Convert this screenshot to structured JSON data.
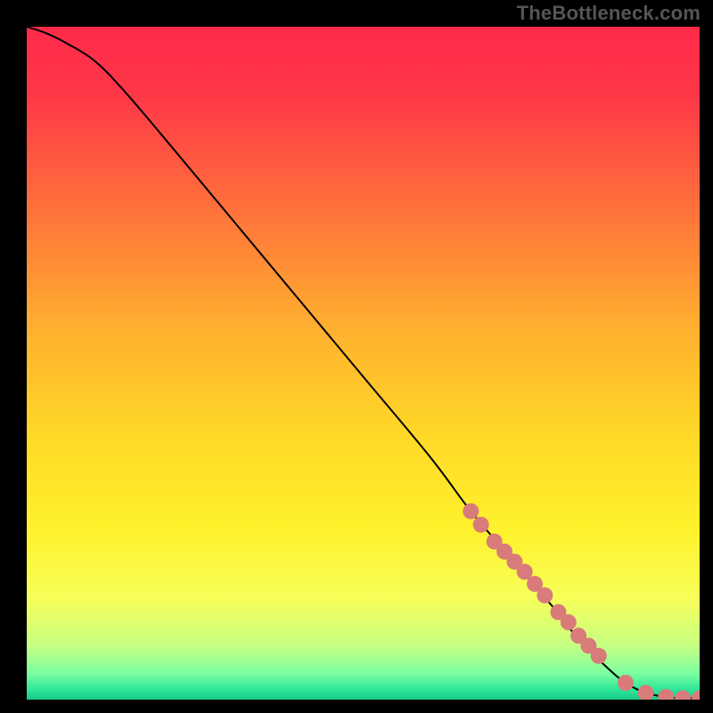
{
  "watermark": "TheBottleneck.com",
  "chart_data": {
    "type": "line",
    "title": "",
    "xlabel": "",
    "ylabel": "",
    "xlim": [
      0,
      100
    ],
    "ylim": [
      0,
      100
    ],
    "background_gradient_stops": [
      {
        "offset": 0.0,
        "color": "#ff2a4a"
      },
      {
        "offset": 0.1,
        "color": "#ff3748"
      },
      {
        "offset": 0.25,
        "color": "#ff6a3c"
      },
      {
        "offset": 0.45,
        "color": "#ffb02f"
      },
      {
        "offset": 0.6,
        "color": "#ffd727"
      },
      {
        "offset": 0.75,
        "color": "#fff22c"
      },
      {
        "offset": 0.85,
        "color": "#f7ff5a"
      },
      {
        "offset": 0.92,
        "color": "#c6ff82"
      },
      {
        "offset": 0.96,
        "color": "#7effa0"
      },
      {
        "offset": 0.985,
        "color": "#2fe69a"
      },
      {
        "offset": 1.0,
        "color": "#16c98a"
      }
    ],
    "series": [
      {
        "name": "curve",
        "x": [
          0,
          3,
          6,
          10,
          14,
          20,
          30,
          40,
          50,
          60,
          66,
          72,
          78,
          82,
          86,
          89,
          92,
          95,
          97,
          100
        ],
        "y": [
          100,
          99,
          97.5,
          95,
          91,
          84,
          72,
          60,
          48,
          36,
          28,
          21,
          14,
          9,
          5,
          2.5,
          1,
          0.4,
          0.2,
          0.2
        ]
      }
    ],
    "markers": {
      "name": "highlighted-points",
      "color": "#d97b7b",
      "radius_px": 9,
      "x": [
        66,
        67.5,
        69.5,
        71,
        72.5,
        74,
        75.5,
        77,
        79,
        80.5,
        82,
        83.5,
        85,
        89,
        92,
        95,
        97.5,
        100
      ],
      "y": [
        28,
        26,
        23.5,
        22,
        20.5,
        19,
        17.2,
        15.5,
        13,
        11.5,
        9.5,
        8,
        6.5,
        2.5,
        1,
        0.4,
        0.2,
        0.2
      ]
    }
  }
}
